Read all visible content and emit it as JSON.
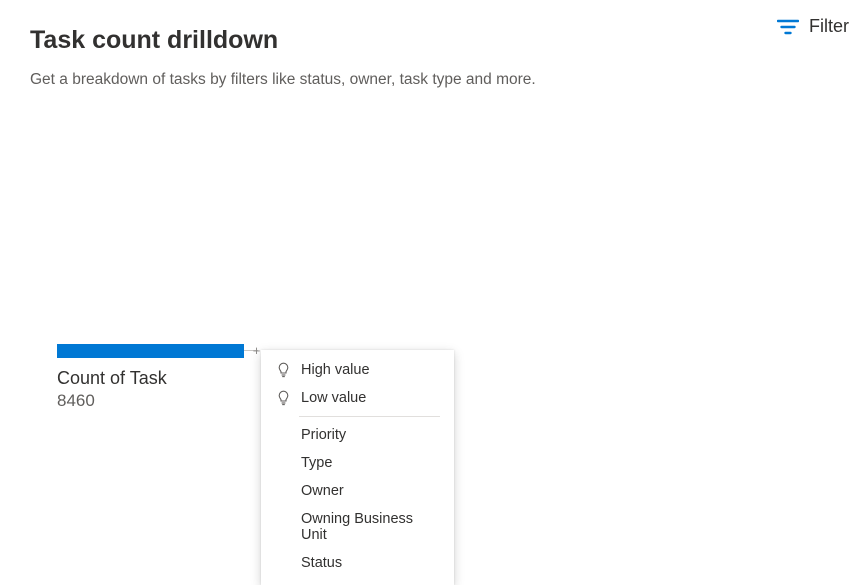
{
  "header": {
    "title": "Task count drilldown",
    "subtitle": "Get a breakdown of tasks by filters like status, owner, task type and more.",
    "filter_label": "Filter"
  },
  "metric": {
    "label": "Count of Task",
    "value": "8460"
  },
  "dropdown": {
    "insight_items": [
      {
        "label": "High value"
      },
      {
        "label": "Low value"
      }
    ],
    "field_items": [
      {
        "label": "Priority"
      },
      {
        "label": "Type"
      },
      {
        "label": "Owner"
      },
      {
        "label": "Owning Business Unit"
      },
      {
        "label": "Status"
      }
    ]
  },
  "chart_data": {
    "type": "bar",
    "title": "Count of Task",
    "categories": [
      "Count of Task"
    ],
    "values": [
      8460
    ]
  }
}
